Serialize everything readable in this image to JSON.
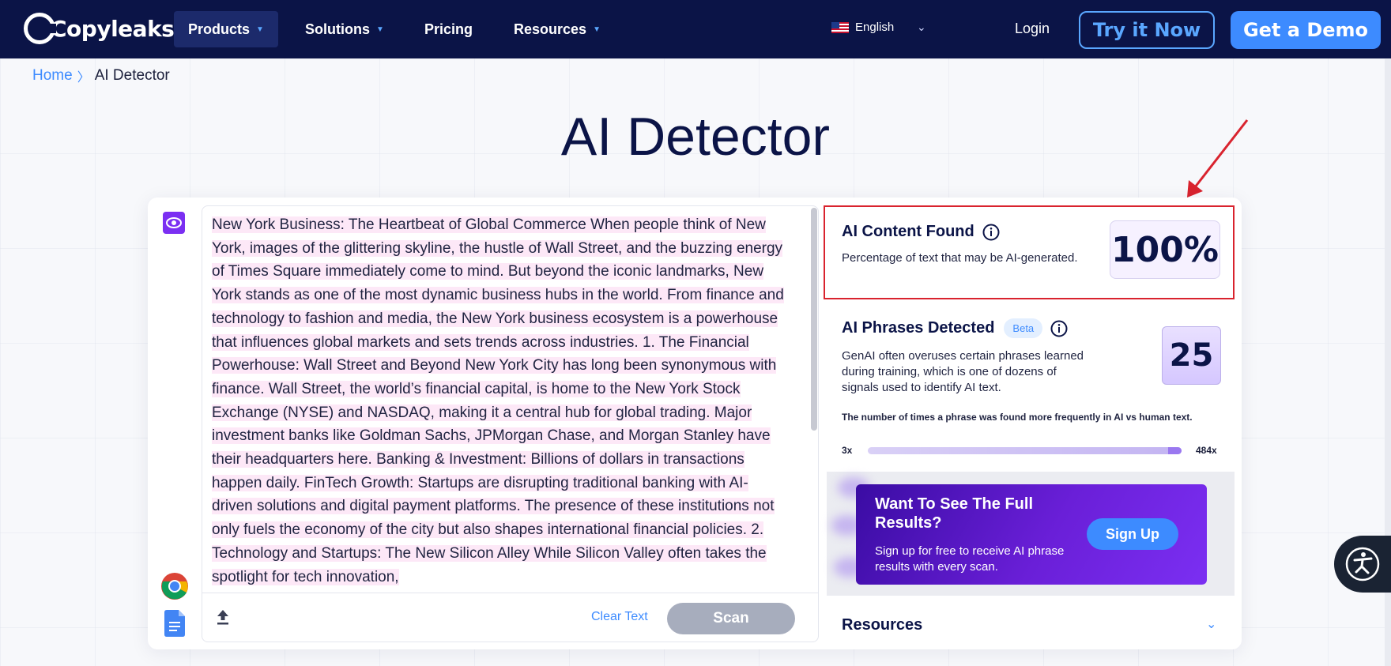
{
  "nav": {
    "logo": "Copyleaks",
    "items": [
      {
        "label": "Products",
        "dropdown": true,
        "active": true
      },
      {
        "label": "Solutions",
        "dropdown": true,
        "active": false
      },
      {
        "label": "Pricing",
        "dropdown": false,
        "active": false
      },
      {
        "label": "Resources",
        "dropdown": true,
        "active": false
      }
    ],
    "language": "English",
    "login": "Login",
    "try_label": "Try it Now",
    "demo_label": "Get a Demo"
  },
  "breadcrumb": {
    "home": "Home",
    "separator": "〉",
    "current": "AI Detector"
  },
  "page_title": "AI Detector",
  "editor": {
    "text": "New York Business: The Heartbeat of Global Commerce When people think of New York, images of the glittering skyline, the hustle of Wall Street, and the buzzing energy of Times Square immediately come to mind. But beyond the iconic landmarks, New York stands as one of the most dynamic business hubs in the world. From finance and technology to fashion and media, the New York business ecosystem is a powerhouse that influences global markets and sets trends across industries. 1. The Financial Powerhouse: Wall Street and Beyond New York City has long been synonymous with finance. Wall Street, the world’s financial capital, is home to the New York Stock Exchange (NYSE) and NASDAQ, making it a central hub for global trading. Major investment banks like Goldman Sachs, JPMorgan Chase, and Morgan Stanley have their headquarters here. Banking & Investment: Billions of dollars in transactions happen daily. FinTech Growth: Startups are disrupting traditional banking with AI-driven solutions and digital payment platforms. The presence of these institutions not only fuels the economy of the city but also shapes international financial policies. 2. Technology and Startups: The New Silicon Alley While Silicon Valley often takes the spotlight for tech innovation,",
    "clear_label": "Clear Text",
    "scan_label": "Scan"
  },
  "results": {
    "ai_found_title": "AI Content Found",
    "ai_found_sub": "Percentage of text that may be AI-generated.",
    "ai_percentage": "100%",
    "phrases_title": "AI Phrases Detected",
    "beta": "Beta",
    "phrases_desc": "GenAI often overuses certain phrases learned during training, which is one of dozens of signals used to identify AI text.",
    "phrase_count": "25",
    "freq_note": "The number of times a phrase was found more frequently in AI vs human text.",
    "range_min": "3x",
    "range_max": "484x",
    "cta_title": "Want To See The Full Results?",
    "cta_sub": "Sign up for free to receive AI phrase results with every scan.",
    "signup_label": "Sign Up",
    "resources_label": "Resources"
  },
  "colors": {
    "nav_bg": "#0b1447",
    "accent": "#3d8bff",
    "purple": "#7b2ff2",
    "annotation_red": "#d9232e"
  }
}
